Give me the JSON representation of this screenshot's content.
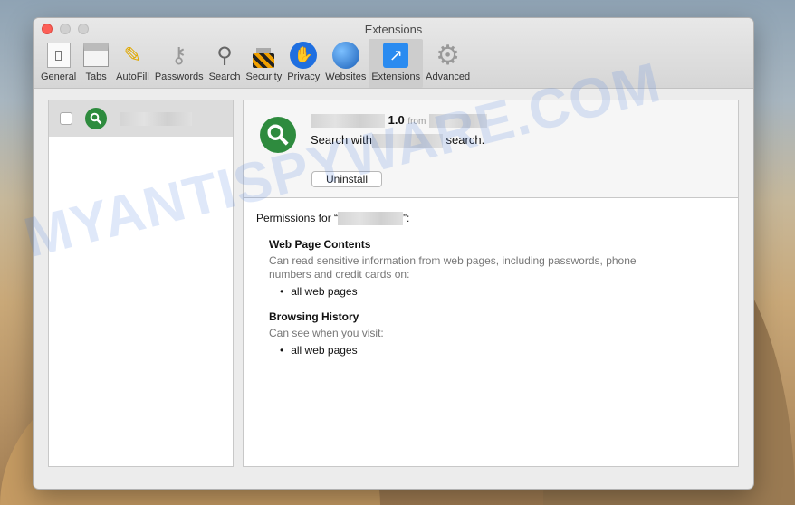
{
  "window": {
    "title": "Extensions"
  },
  "toolbar": [
    {
      "label": "General",
      "icon": "general-switch-icon"
    },
    {
      "label": "Tabs",
      "icon": "tabs-icon"
    },
    {
      "label": "AutoFill",
      "icon": "pencil-icon"
    },
    {
      "label": "Passwords",
      "icon": "key-icon"
    },
    {
      "label": "Search",
      "icon": "magnifier-icon"
    },
    {
      "label": "Security",
      "icon": "lock-icon"
    },
    {
      "label": "Privacy",
      "icon": "hand-icon"
    },
    {
      "label": "Websites",
      "icon": "globe-icon"
    },
    {
      "label": "Extensions",
      "icon": "puzzle-compass-icon",
      "selected": true
    },
    {
      "label": "Advanced",
      "icon": "gear-icon"
    }
  ],
  "extension": {
    "version": "1.0",
    "from_label": "from",
    "desc_prefix": "Search with",
    "desc_suffix": "search.",
    "uninstall_label": "Uninstall",
    "enabled": false,
    "accent": "#2e8b3e"
  },
  "permissions": {
    "intro_prefix": "Permissions for “",
    "intro_suffix": "”:",
    "sections": [
      {
        "title": "Web Page Contents",
        "desc": "Can read sensitive information from web pages, including passwords, phone numbers and credit cards on:",
        "item": "all web pages"
      },
      {
        "title": "Browsing History",
        "desc": "Can see when you visit:",
        "item": "all web pages"
      }
    ]
  },
  "watermark": "MYANTISPYWARE.COM"
}
